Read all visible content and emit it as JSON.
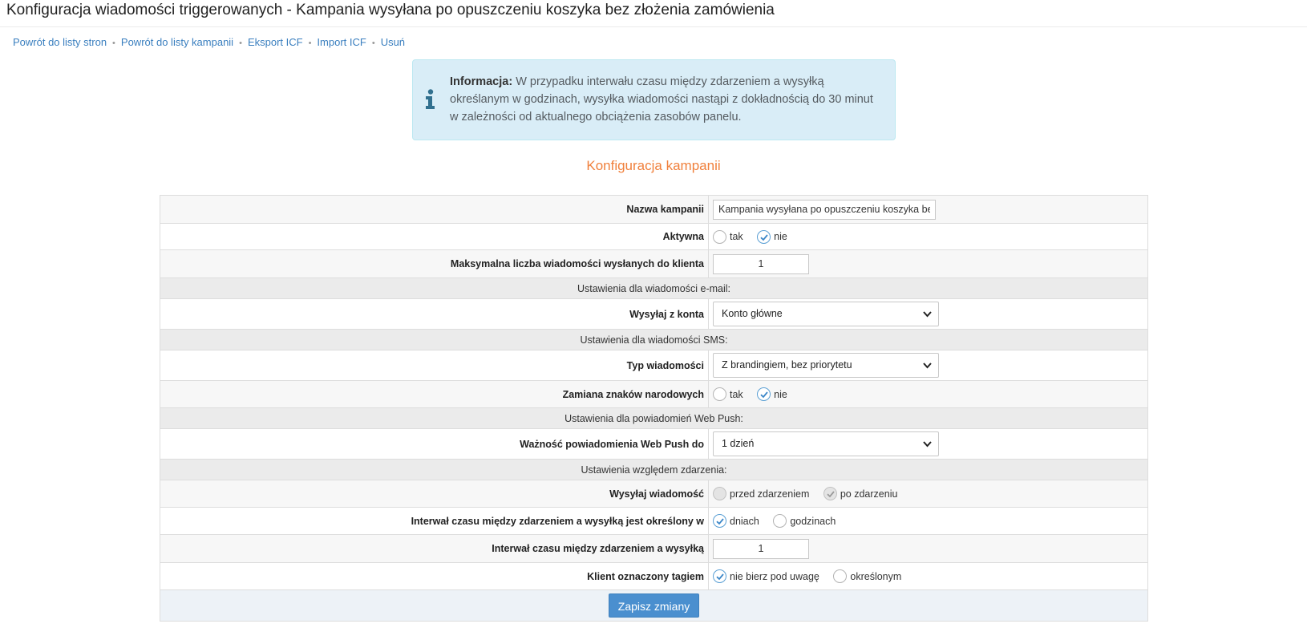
{
  "page": {
    "title": "Konfiguracja wiadomości triggerowanych - Kampania wysyłana po opuszczeniu koszyka bez złożenia zamówienia"
  },
  "nav": {
    "links": [
      "Powrót do listy stron",
      "Powrót do listy kampanii",
      "Eksport ICF",
      "Import ICF",
      "Usuń"
    ],
    "separator": "•"
  },
  "info": {
    "icon": "info-icon",
    "label": "Informacja:",
    "text": " W przypadku interwału czasu między zdarzeniem a wysyłką określanym w godzinach, wysyłka wiadomości nastąpi z dokładnością do 30 minut w zależności od aktualnego obciążenia zasobów panelu."
  },
  "section_heading": "Konfiguracja kampanii",
  "form": {
    "campaign_name": {
      "label": "Nazwa kampanii",
      "value": "Kampania wysyłana po opuszczeniu koszyka bez złożenia zamówienia"
    },
    "active": {
      "label": "Aktywna",
      "options": [
        "tak",
        "nie"
      ],
      "selected": "nie"
    },
    "max_messages": {
      "label": "Maksymalna liczba wiadomości wysłanych do klienta",
      "value": "1"
    },
    "email_section": "Ustawienia dla wiadomości e-mail:",
    "send_from": {
      "label": "Wysyłaj z konta",
      "value": "Konto główne"
    },
    "sms_section": "Ustawienia dla wiadomości SMS:",
    "message_type": {
      "label": "Typ wiadomości",
      "value": "Z brandingiem, bez priorytetu"
    },
    "national_chars": {
      "label": "Zamiana znaków narodowych",
      "options": [
        "tak",
        "nie"
      ],
      "selected": "nie"
    },
    "webpush_section": "Ustawienia dla powiadomień Web Push:",
    "webpush_validity": {
      "label": "Ważność powiadomienia Web Push do",
      "value": "1 dzień"
    },
    "event_section": "Ustawienia względem zdarzenia:",
    "send_message": {
      "label": "Wysyłaj wiadomość",
      "options": [
        "przed zdarzeniem",
        "po zdarzeniu"
      ],
      "selected": "po zdarzeniu",
      "disabled": true
    },
    "interval_unit": {
      "label": "Interwał czasu między zdarzeniem a wysyłką jest określony w",
      "options": [
        "dniach",
        "godzinach"
      ],
      "selected": "dniach"
    },
    "interval_value": {
      "label": "Interwał czasu między zdarzeniem a wysyłką",
      "value": "1"
    },
    "tagged_client": {
      "label": "Klient oznaczony tagiem",
      "options": [
        "nie bierz pod uwagę",
        "określonym"
      ],
      "selected": "nie bierz pod uwagę"
    },
    "save_label": "Zapisz zmiany"
  },
  "colors": {
    "link": "#3a7fbf",
    "heading_accent": "#f0803c",
    "info_bg": "#d9edf7",
    "button": "#4a8fcf"
  }
}
